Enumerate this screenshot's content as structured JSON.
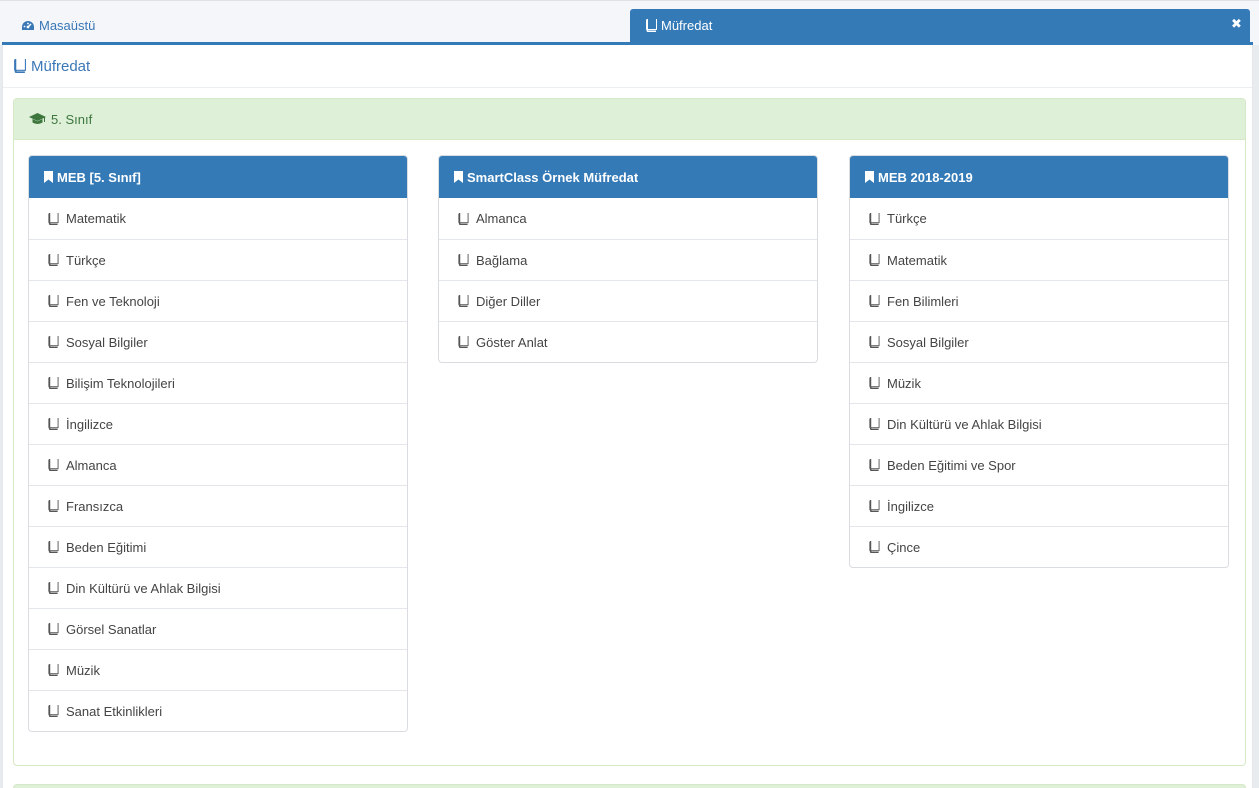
{
  "tabs": [
    {
      "label": "Masaüstü",
      "icon": "dashboard-icon",
      "active": false
    },
    {
      "label": "Müfredat",
      "icon": "book-icon",
      "active": true
    }
  ],
  "page": {
    "title": "Müfredat",
    "icon": "book-icon"
  },
  "grade": {
    "title": "5. Sınıf",
    "icon": "graduation-cap-icon"
  },
  "curricula": [
    {
      "title": "MEB [5. Sınıf]",
      "icon": "bookmark-icon",
      "subjects": [
        "Matematik",
        "Türkçe",
        "Fen ve Teknoloji",
        "Sosyal Bilgiler",
        "Bilişim Teknolojileri",
        "İngilizce",
        "Almanca",
        "Fransızca",
        "Beden Eğitimi",
        "Din Kültürü ve Ahlak Bilgisi",
        "Görsel Sanatlar",
        "Müzik",
        "Sanat Etkinlikleri"
      ]
    },
    {
      "title": "SmartClass Örnek Müfredat",
      "icon": "bookmark-icon",
      "subjects": [
        "Almanca",
        "Bağlama",
        "Diğer Diller",
        "Göster Anlat"
      ]
    },
    {
      "title": "MEB 2018-2019",
      "icon": "bookmark-icon",
      "subjects": [
        "Türkçe",
        "Matematik",
        "Fen Bilimleri",
        "Sosyal Bilgiler",
        "Müzik",
        "Din Kültürü ve Ahlak Bilgisi",
        "Beden Eğitimi ve Spor",
        "İngilizce",
        "Çince"
      ]
    }
  ],
  "colors": {
    "primary": "#337ab7",
    "success_bg": "#dff0d8",
    "success_text": "#3c763d"
  }
}
